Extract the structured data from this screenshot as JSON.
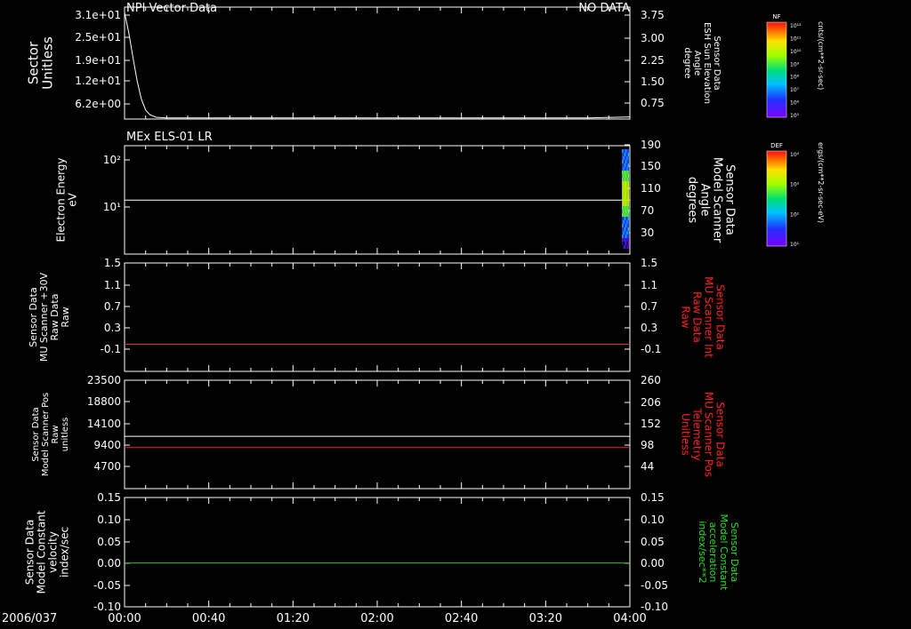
{
  "header": {
    "left_title": "NPI Vector Data",
    "right_title": "NO DATA",
    "panel2_title": "MEx ELS-01 LR"
  },
  "date_label": "2006/037",
  "colors": {
    "white": "#ffffff",
    "red": "#ff2020",
    "green": "#20e020"
  },
  "colorbars": [
    {
      "tag": "NF",
      "units": "cnts/(cm**2-sr-sec)",
      "ticks": [
        "10¹²",
        "10¹¹",
        "10¹⁰",
        "10⁹",
        "10⁸",
        "10⁷",
        "10⁶",
        "10⁵"
      ]
    },
    {
      "tag": "DEF",
      "units": "ergs/(cm**2-sr-sec-eV)",
      "ticks": [
        "10⁴",
        "10³",
        "10²",
        "10¹"
      ]
    }
  ],
  "chart_data": [
    {
      "type": "line",
      "x_ticks": [
        "00:00",
        "00:40",
        "01:20",
        "02:00",
        "02:40",
        "03:20",
        "04:00"
      ],
      "xlim": [
        "00:00",
        "04:00"
      ],
      "left_axis": {
        "label_lines": [
          "Sector",
          "Unitless"
        ],
        "ticks": [
          "3.1e+01",
          "2.5e+01",
          "1.9e+01",
          "1.2e+01",
          "6.2e+00"
        ],
        "ylim": [
          0,
          31
        ]
      },
      "right_axis": {
        "label_lines": [
          "Sensor Data",
          "ESH Sun Elevation",
          "Angle",
          "degree"
        ],
        "ticks": [
          "3.75",
          "3.00",
          "2.25",
          "1.50",
          "0.75"
        ]
      },
      "series": [
        {
          "x": [
            "00:00",
            "00:02",
            "00:04",
            "00:06",
            "00:08",
            "00:10",
            "00:12",
            "00:15",
            "00:20",
            "03:40",
            "04:00"
          ],
          "y": [
            29.5,
            24,
            17,
            10.5,
            5.5,
            2.5,
            1.2,
            0.5,
            0.3,
            0.3,
            0.6
          ]
        }
      ]
    },
    {
      "type": "heatmap",
      "left_axis": {
        "label_lines": [
          "Electron Energy",
          "eV"
        ],
        "ticks": [
          "10²",
          "10¹"
        ],
        "scale": "log"
      },
      "right_axis": {
        "label_lines": [
          "Sensor Data",
          "Model Scanner",
          "Angle",
          "degrees"
        ],
        "ticks": [
          "190",
          "150",
          "110",
          "70",
          "30"
        ]
      },
      "series": [
        {
          "x": [
            "00:00",
            "04:00"
          ],
          "y": [
            14,
            14
          ]
        }
      ],
      "heatmap_block": {
        "x_start": "03:55",
        "x_end": "04:00"
      }
    },
    {
      "type": "line",
      "left_axis": {
        "label_lines": [
          "Sensor Data",
          "MU Scanner +30V",
          "Raw Data",
          "Raw"
        ],
        "ticks": [
          "1.5",
          "1.1",
          "0.7",
          "0.3",
          "-0.1"
        ],
        "ylim": [
          -0.5,
          1.5
        ]
      },
      "right_axis": {
        "label_lines": [
          "Sensor Data",
          "MU Scanner Int",
          "Raw Data",
          "Raw"
        ],
        "ticks": [
          "1.5",
          "1.1",
          "0.7",
          "0.3",
          "-0.1"
        ]
      },
      "series": [
        {
          "x": [
            "00:00",
            "04:00"
          ],
          "y": [
            0.0,
            0.0
          ]
        }
      ]
    },
    {
      "type": "line",
      "left_axis": {
        "label_lines": [
          "Sensor Data",
          "Model Scanner Pos",
          "Raw",
          "unitless"
        ],
        "ticks": [
          "23500",
          "18800",
          "14100",
          "9400",
          "4700"
        ],
        "ylim": [
          0,
          23500
        ]
      },
      "right_axis": {
        "label_lines": [
          "Sensor Data",
          "MU Scanner Pos",
          "Telemetry",
          "Unitless"
        ],
        "ticks": [
          "260",
          "206",
          "152",
          "98",
          "44"
        ]
      },
      "series": [
        {
          "x": [
            "00:00",
            "04:00"
          ],
          "y": [
            11350,
            11350
          ]
        },
        {
          "x": [
            "00:00",
            "04:00"
          ],
          "y": [
            8900,
            8900
          ]
        }
      ]
    },
    {
      "type": "line",
      "left_axis": {
        "label_lines": [
          "Sensor Data",
          "Model Constant",
          "velocity",
          "index/sec"
        ],
        "ticks": [
          "0.15",
          "0.10",
          "0.05",
          "0.00",
          "-0.05",
          "-0.10"
        ],
        "ylim": [
          -0.1,
          0.15
        ]
      },
      "right_axis": {
        "label_lines": [
          "Sensor Data",
          "Model Constant",
          "acceleration",
          "index/sec**2"
        ],
        "ticks": [
          "0.15",
          "0.10",
          "0.05",
          "0.00",
          "-0.05",
          "-0.10"
        ]
      },
      "series": [
        {
          "x": [
            "00:00",
            "04:00"
          ],
          "y": [
            0.0,
            0.0
          ]
        }
      ]
    }
  ]
}
